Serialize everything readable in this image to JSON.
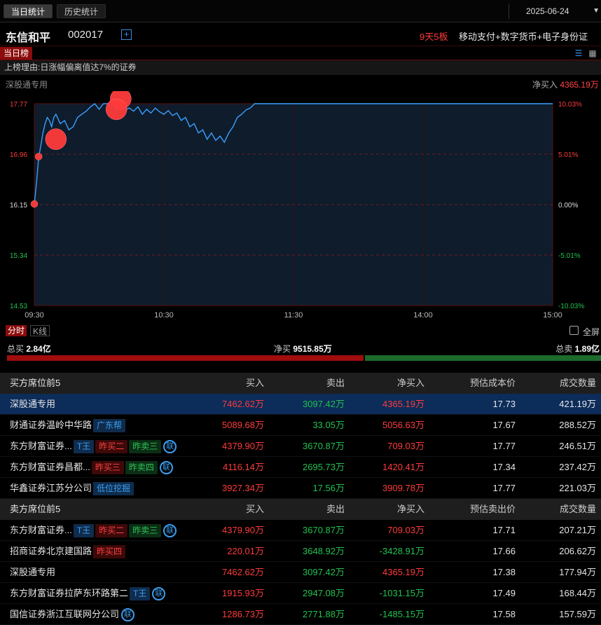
{
  "tabs": [
    {
      "label": "当日统计",
      "active": true
    },
    {
      "label": "历史统计",
      "active": false
    }
  ],
  "date": "2025-06-24",
  "stock": {
    "name": "东信和平",
    "code": "002017",
    "streak": "9天5板",
    "concept": "移动支付+数字货币+电子身份证"
  },
  "section": {
    "tag": "当日榜"
  },
  "reason": "上榜理由:日涨幅偏离值达7%的证券",
  "seat": {
    "name": "深股通专用",
    "net_label": "净买入",
    "net_value": "4365.19万"
  },
  "chart_data": {
    "type": "line",
    "title": "",
    "y_left_ticks": [
      "17.77",
      "16.96",
      "16.15",
      "15.34",
      "14.53"
    ],
    "y_right_ticks": [
      "10.03%",
      "5.01%",
      "0.00%",
      "-5.01%",
      "-10.03%"
    ],
    "x_ticks": [
      "09:30",
      "10:30",
      "11:30",
      "14:00",
      "15:00"
    ],
    "ylim": [
      14.53,
      17.77
    ],
    "xlim_minutes": [
      0,
      240
    ],
    "series": [
      {
        "points": [
          [
            0,
            16.15
          ],
          [
            1,
            16.5
          ],
          [
            2,
            16.9
          ],
          [
            3,
            17.1
          ],
          [
            4,
            17.3
          ],
          [
            5,
            17.45
          ],
          [
            6,
            17.55
          ],
          [
            7,
            17.5
          ],
          [
            8,
            17.4
          ],
          [
            9,
            17.55
          ],
          [
            10,
            17.6
          ],
          [
            12,
            17.45
          ],
          [
            14,
            17.5
          ],
          [
            16,
            17.35
          ],
          [
            18,
            17.4
          ],
          [
            20,
            17.55
          ],
          [
            22,
            17.6
          ],
          [
            24,
            17.65
          ],
          [
            26,
            17.72
          ],
          [
            28,
            17.77
          ],
          [
            30,
            17.68
          ],
          [
            32,
            17.77
          ],
          [
            34,
            17.77
          ],
          [
            36,
            17.7
          ],
          [
            38,
            17.68
          ],
          [
            40,
            17.74
          ],
          [
            42,
            17.67
          ],
          [
            44,
            17.7
          ],
          [
            46,
            17.65
          ],
          [
            48,
            17.72
          ],
          [
            50,
            17.6
          ],
          [
            52,
            17.68
          ],
          [
            54,
            17.62
          ],
          [
            56,
            17.7
          ],
          [
            58,
            17.64
          ],
          [
            60,
            17.6
          ],
          [
            62,
            17.66
          ],
          [
            64,
            17.58
          ],
          [
            66,
            17.62
          ],
          [
            68,
            17.5
          ],
          [
            70,
            17.55
          ],
          [
            72,
            17.4
          ],
          [
            74,
            17.45
          ],
          [
            76,
            17.3
          ],
          [
            78,
            17.35
          ],
          [
            80,
            17.2
          ],
          [
            82,
            17.3
          ],
          [
            84,
            17.18
          ],
          [
            86,
            17.25
          ],
          [
            88,
            17.15
          ],
          [
            90,
            17.3
          ],
          [
            92,
            17.4
          ],
          [
            94,
            17.55
          ],
          [
            96,
            17.6
          ],
          [
            98,
            17.67
          ],
          [
            100,
            17.7
          ],
          [
            102,
            17.77
          ],
          [
            120,
            17.77
          ],
          [
            240,
            17.77
          ]
        ]
      }
    ],
    "markers": [
      {
        "t": 0,
        "v": 16.16,
        "size": "small"
      },
      {
        "t": 2,
        "v": 16.92,
        "size": "small"
      },
      {
        "t": 10,
        "v": 17.2,
        "size": "large"
      },
      {
        "t": 40,
        "v": 17.85,
        "size": "large"
      },
      {
        "t": 38,
        "v": 17.68,
        "size": "large"
      }
    ],
    "net_buy_label": "净买入"
  },
  "modes": {
    "active": "分时",
    "other": "K线"
  },
  "fullscreen": "全屏",
  "summary": {
    "buy_label": "总买",
    "buy_value": "2.84亿",
    "net_label": "净买",
    "net_value": "9515.85万",
    "sell_label": "总卖",
    "sell_value": "1.89亿",
    "buy_ratio": 0.6
  },
  "buy_table": {
    "headers": [
      "买方席位前5",
      "买入",
      "卖出",
      "净买入",
      "预估成本价",
      "成交数量"
    ],
    "rows": [
      {
        "name": "深股通专用",
        "buy": "7462.62万",
        "sell": "3097.42万",
        "net": "4365.19万",
        "price": "17.73",
        "vol": "421.19万",
        "hl": true,
        "badges": []
      },
      {
        "name": "财通证券温岭中华路",
        "buy": "5089.68万",
        "sell": "33.05万",
        "net": "5056.63万",
        "price": "17.67",
        "vol": "288.52万",
        "badges": [
          {
            "t": "广东帮",
            "c": "blue"
          }
        ]
      },
      {
        "name": "东方财富证券...",
        "buy": "4379.90万",
        "sell": "3670.87万",
        "net": "709.03万",
        "price": "17.77",
        "vol": "246.51万",
        "badges": [
          {
            "t": "T王",
            "c": "blue"
          },
          {
            "t": "昨买二",
            "c": "red"
          },
          {
            "t": "昨卖三",
            "c": "green"
          },
          {
            "t": "联",
            "c": "lian"
          }
        ]
      },
      {
        "name": "东方财富证券昌都...",
        "buy": "4116.14万",
        "sell": "2695.73万",
        "net": "1420.41万",
        "price": "17.34",
        "vol": "237.42万",
        "badges": [
          {
            "t": "昨买三",
            "c": "red"
          },
          {
            "t": "昨卖四",
            "c": "green"
          },
          {
            "t": "联",
            "c": "lian"
          }
        ]
      },
      {
        "name": "华鑫证券江苏分公司",
        "buy": "3927.34万",
        "sell": "17.56万",
        "net": "3909.78万",
        "price": "17.77",
        "vol": "221.03万",
        "badges": [
          {
            "t": "低位挖掘",
            "c": "blue"
          }
        ]
      }
    ]
  },
  "sell_table": {
    "headers": [
      "卖方席位前5",
      "买入",
      "卖出",
      "净买入",
      "预估卖出价",
      "成交数量"
    ],
    "rows": [
      {
        "name": "东方财富证券...",
        "buy": "4379.90万",
        "sell": "3670.87万",
        "net": "709.03万",
        "price": "17.71",
        "vol": "207.21万",
        "badges": [
          {
            "t": "T王",
            "c": "blue"
          },
          {
            "t": "昨买二",
            "c": "red"
          },
          {
            "t": "昨卖三",
            "c": "green"
          },
          {
            "t": "联",
            "c": "lian"
          }
        ]
      },
      {
        "name": "招商证券北京建国路",
        "buy": "220.01万",
        "sell": "3648.92万",
        "net": "-3428.91万",
        "price": "17.66",
        "vol": "206.62万",
        "badges": [
          {
            "t": "昨买四",
            "c": "red"
          }
        ]
      },
      {
        "name": "深股通专用",
        "buy": "7462.62万",
        "sell": "3097.42万",
        "net": "4365.19万",
        "price": "17.38",
        "vol": "177.94万",
        "badges": []
      },
      {
        "name": "东方财富证券拉萨东环路第二",
        "buy": "1915.93万",
        "sell": "2947.08万",
        "net": "-1031.15万",
        "price": "17.49",
        "vol": "168.44万",
        "badges": [
          {
            "t": "T王",
            "c": "blue"
          },
          {
            "t": "联",
            "c": "lian"
          }
        ]
      },
      {
        "name": "国信证券浙江互联网分公司",
        "buy": "1286.73万",
        "sell": "2771.88万",
        "net": "-1485.15万",
        "price": "17.58",
        "vol": "157.59万",
        "badges": [
          {
            "t": "联",
            "c": "lian"
          }
        ]
      }
    ]
  },
  "colors": {
    "up": "#ff3b3b",
    "down": "#22c24f",
    "line": "#3aa0ff",
    "panel": "#0e1c2c"
  }
}
